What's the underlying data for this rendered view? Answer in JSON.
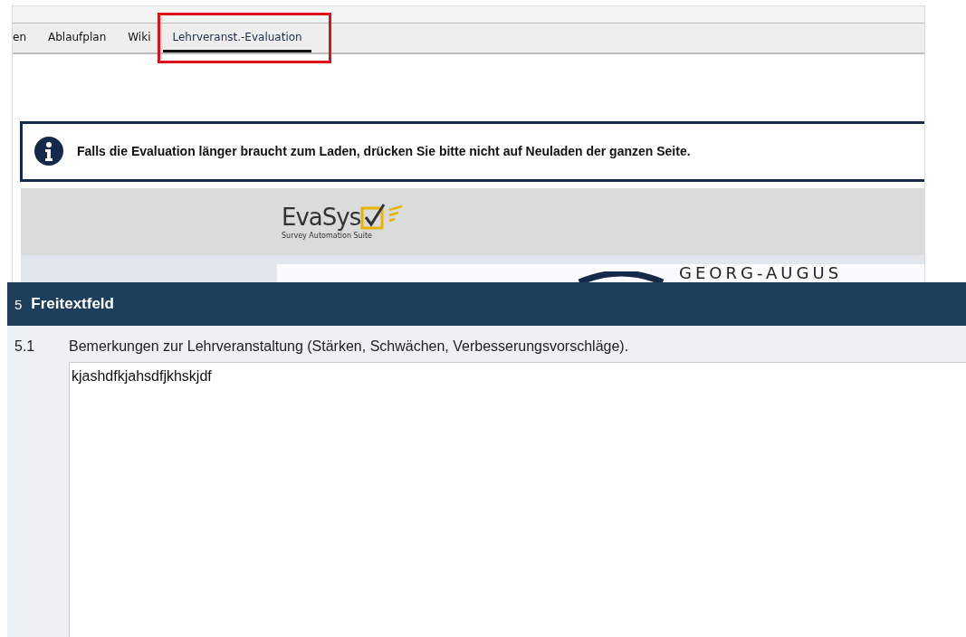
{
  "tabs": [
    {
      "label": "en",
      "selected": false,
      "highlighted": false
    },
    {
      "label": "Ablaufplan",
      "selected": false,
      "highlighted": false
    },
    {
      "label": "Wiki",
      "selected": false,
      "highlighted": false
    },
    {
      "label": "Lehrveranst.-Evaluation",
      "selected": true,
      "highlighted": true
    }
  ],
  "notice": {
    "text": "Falls die Evaluation länger braucht zum Laden, drücken Sie bitte nicht auf Neuladen der ganzen Seite."
  },
  "logo": {
    "name": "EvaSys",
    "tagline": "Survey Automation Suite"
  },
  "university_banner": {
    "text": "GEORG-AUGUS"
  },
  "section": {
    "number": "5",
    "title": "Freitextfeld",
    "questions": [
      {
        "number": "5.1",
        "text": "Bemerkungen zur Lehrveranstaltung (Stärken, Schwächen, Verbesserungsvorschläge).",
        "value": "kjashdfkjahsdfjkhskjdf"
      }
    ]
  }
}
